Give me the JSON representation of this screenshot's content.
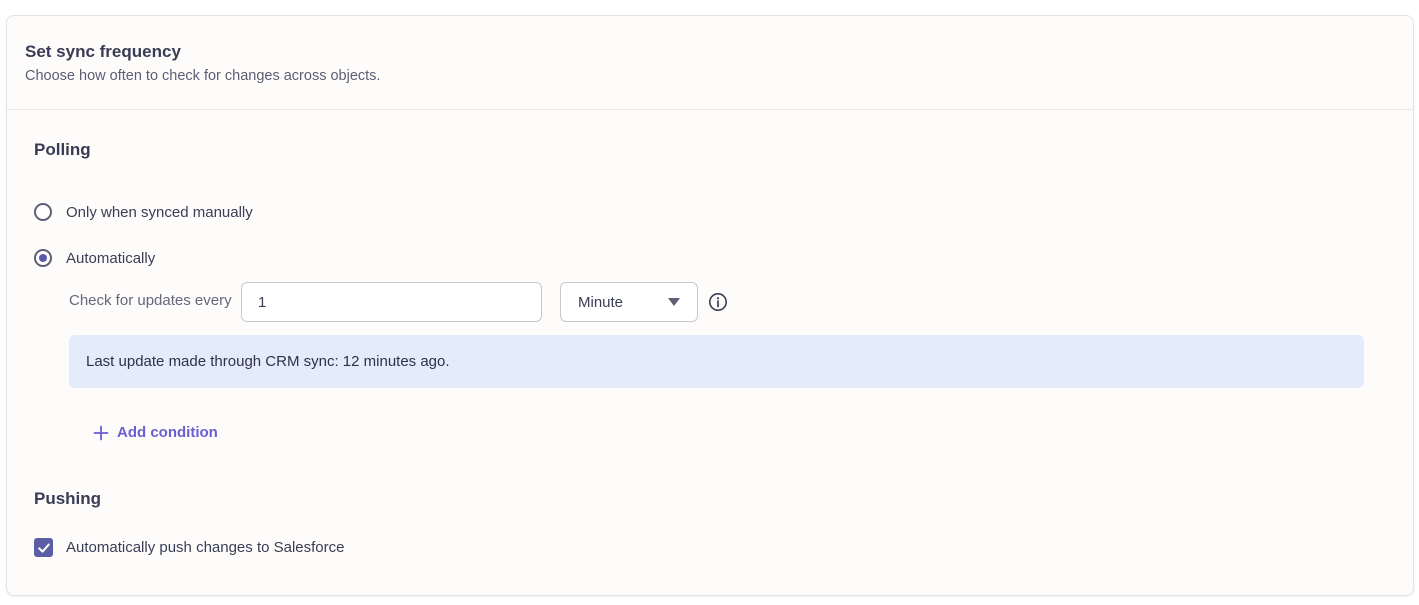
{
  "header": {
    "title": "Set sync frequency",
    "subtitle": "Choose how often to check for changes across objects."
  },
  "polling": {
    "title": "Polling",
    "options": [
      {
        "label": "Only when synced manually",
        "selected": false
      },
      {
        "label": "Automatically",
        "selected": true
      }
    ],
    "frequency": {
      "label": "Check for updates every",
      "value": "1",
      "unit": "Minute"
    },
    "info_message": "Last update made through CRM sync: 12 minutes ago.",
    "add_condition_label": "Add condition"
  },
  "pushing": {
    "title": "Pushing",
    "checkbox_label": "Automatically push changes to Salesforce",
    "checked": true
  },
  "colors": {
    "accent": "#6a5fd0",
    "checkbox_fill": "#5c5ea4",
    "info_banner_bg": "#e4ecfb",
    "card_bg": "#fdfcfb"
  },
  "icons": {
    "info": "info-circle-icon",
    "add": "plus-icon",
    "dropdown": "caret-down-icon",
    "check": "checkmark-icon"
  }
}
